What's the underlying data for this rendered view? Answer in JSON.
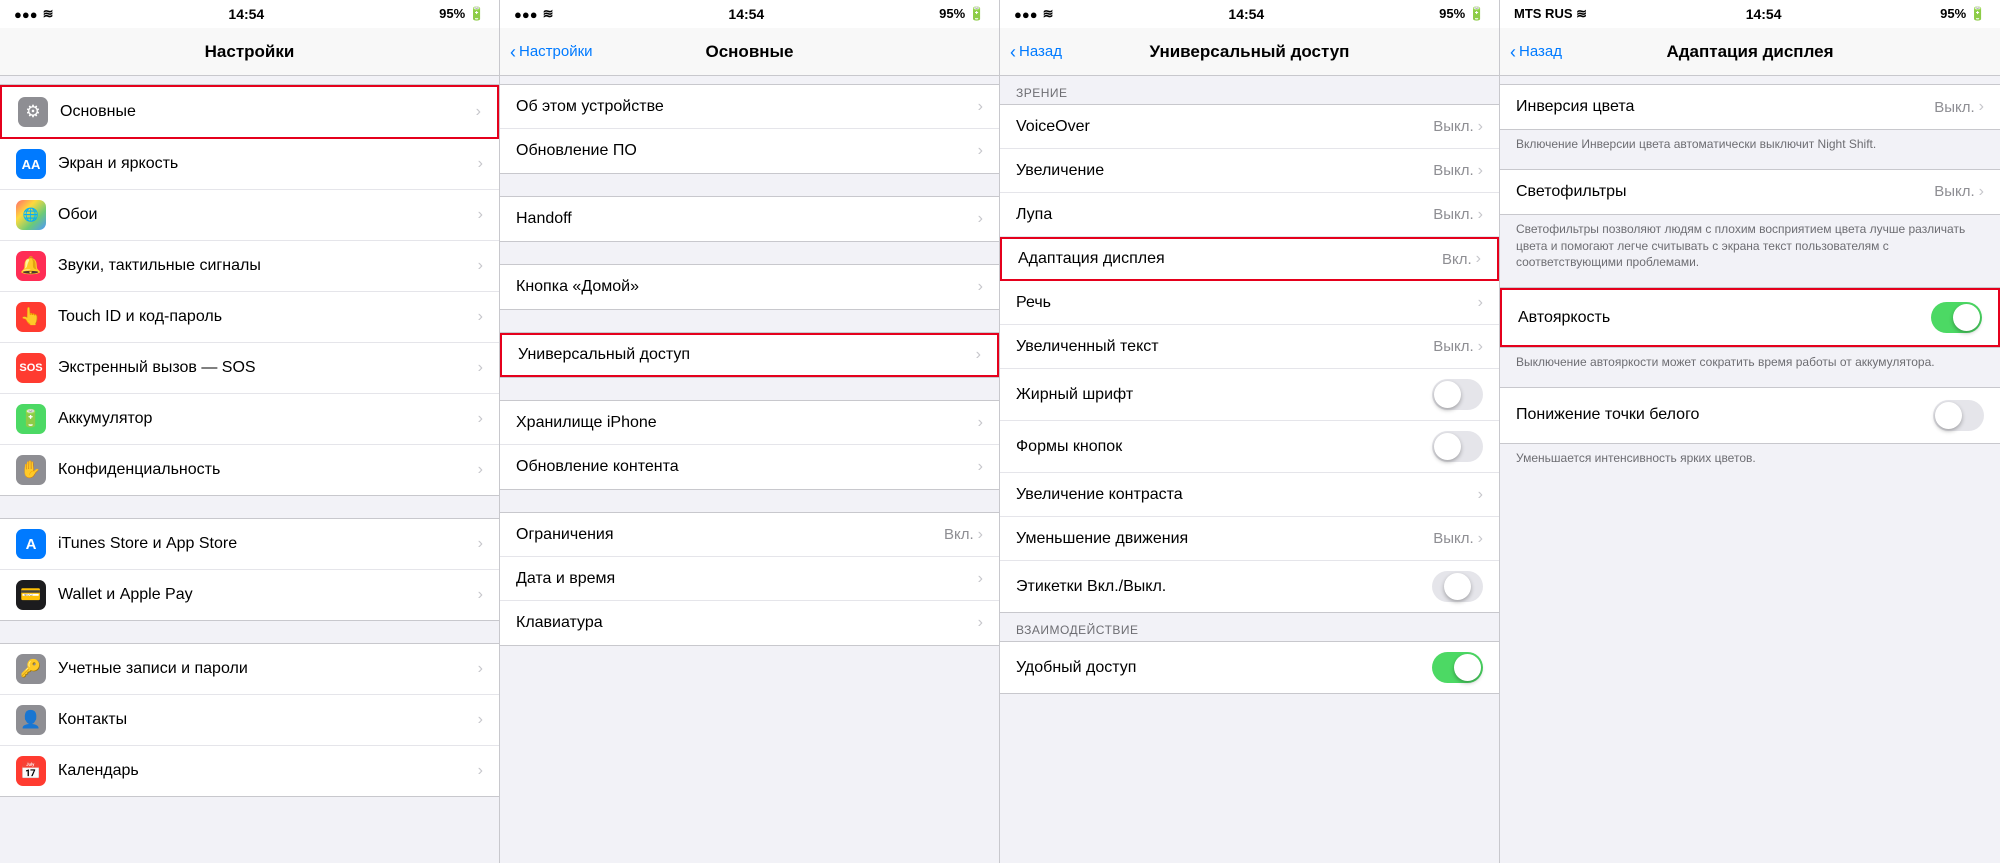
{
  "screens": [
    {
      "id": "screen1",
      "statusBar": {
        "left": "●●● ≋",
        "center": "14:54",
        "right": "95% 🔋"
      },
      "header": {
        "title": "Настройки",
        "backLabel": null
      },
      "groups": [
        {
          "items": [
            {
              "id": "osnovnye",
              "icon": "⚙️",
              "iconBg": "#8e8e93",
              "label": "Основные",
              "value": null,
              "highlighted": true
            },
            {
              "id": "ekran",
              "icon": "AA",
              "iconBg": "#007aff",
              "label": "Экран и яркость",
              "value": null
            },
            {
              "id": "oboi",
              "icon": "🌐",
              "iconBg": "#ff9500",
              "label": "Обои",
              "value": null
            },
            {
              "id": "zvuki",
              "icon": "🔔",
              "iconBg": "#ff2d55",
              "label": "Звуки, тактильные сигналы",
              "value": null
            },
            {
              "id": "touchid",
              "icon": "👆",
              "iconBg": "#ff3b30",
              "label": "Touch ID и код-пароль",
              "value": null
            },
            {
              "id": "ekstrenny",
              "icon": "SOS",
              "iconBg": "#ff3b30",
              "label": "Экстренный вызов — SOS",
              "value": null
            },
            {
              "id": "akkum",
              "icon": "🔋",
              "iconBg": "#4cd964",
              "label": "Аккумулятор",
              "value": null
            },
            {
              "id": "konfid",
              "icon": "✋",
              "iconBg": "#8e8e93",
              "label": "Конфиденциальность",
              "value": null
            }
          ]
        },
        {
          "items": [
            {
              "id": "itunes",
              "icon": "A",
              "iconBg": "#007aff",
              "label": "iTunes Store и App Store",
              "value": null
            },
            {
              "id": "wallet",
              "icon": "💳",
              "iconBg": "#000",
              "label": "Wallet и Apple Pay",
              "value": null
            }
          ]
        },
        {
          "items": [
            {
              "id": "uchet",
              "icon": "🔑",
              "iconBg": "#8e8e93",
              "label": "Учетные записи и пароли",
              "value": null
            },
            {
              "id": "kontakty",
              "icon": "👤",
              "iconBg": "#8e8e93",
              "label": "Контакты",
              "value": null
            },
            {
              "id": "kalendar",
              "icon": "📅",
              "iconBg": "#ff3b30",
              "label": "Календарь",
              "value": null
            }
          ]
        }
      ]
    },
    {
      "id": "screen2",
      "statusBar": {
        "left": "●●● ≋",
        "center": "14:54",
        "right": "95% 🔋"
      },
      "header": {
        "title": "Основные",
        "backLabel": "Настройки"
      },
      "groups": [
        {
          "items": [
            {
              "id": "ob-ustrojstve",
              "label": "Об этом устройстве",
              "value": null
            },
            {
              "id": "obnovlenie-po",
              "label": "Обновление ПО",
              "value": null
            }
          ]
        },
        {
          "items": [
            {
              "id": "handoff",
              "label": "Handoff",
              "value": null
            }
          ]
        },
        {
          "items": [
            {
              "id": "knopka-doma",
              "label": "Кнопка «Домой»",
              "value": null
            }
          ]
        },
        {
          "items": [
            {
              "id": "univ-dostup",
              "label": "Универсальный доступ",
              "value": null,
              "highlighted": true
            }
          ]
        },
        {
          "items": [
            {
              "id": "hranilische",
              "label": "Хранилище iPhone",
              "value": null
            },
            {
              "id": "obnovlenie-kont",
              "label": "Обновление контента",
              "value": null
            }
          ]
        },
        {
          "items": [
            {
              "id": "ogranicheniya",
              "label": "Ограничения",
              "value": "Вкл."
            },
            {
              "id": "data-vremya",
              "label": "Дата и время",
              "value": null
            },
            {
              "id": "klaviatura",
              "label": "Клавиатура",
              "value": null
            }
          ]
        }
      ]
    },
    {
      "id": "screen3",
      "statusBar": {
        "left": "●●● ≋",
        "center": "14:54",
        "right": "95% 🔋"
      },
      "header": {
        "title": "Универсальный доступ",
        "backLabel": "Назад"
      },
      "visionLabel": "ЗРЕНИЕ",
      "visionItems": [
        {
          "id": "voiceover",
          "label": "VoiceOver",
          "value": "Выкл."
        },
        {
          "id": "uvelichenie",
          "label": "Увеличение",
          "value": "Выкл."
        },
        {
          "id": "lupa",
          "label": "Лупа",
          "value": "Выкл."
        },
        {
          "id": "adaptaciya",
          "label": "Адаптация дисплея",
          "value": "Вкл.",
          "highlighted": true
        },
        {
          "id": "rech",
          "label": "Речь",
          "value": null
        },
        {
          "id": "uvelichennyj-tekst",
          "label": "Увеличенный текст",
          "value": "Выкл."
        },
        {
          "id": "zhirnyj-shrift",
          "label": "Жирный шрифт",
          "toggle": "off"
        },
        {
          "id": "formy-knopok",
          "label": "Формы кнопок",
          "toggle": "off"
        },
        {
          "id": "uvelichenie-kontrasta",
          "label": "Увеличение контраста",
          "value": null
        },
        {
          "id": "umenshenie-dvizh",
          "label": "Уменьшение движения",
          "value": "Выкл."
        },
        {
          "id": "etikety",
          "label": "Этикетки Вкл./Выкл.",
          "toggle": "partial"
        }
      ],
      "interactionLabel": "ВЗАИМОДЕЙСТВИЕ",
      "interactionItems": [
        {
          "id": "udobnyj-dostup",
          "label": "Удобный доступ",
          "toggle": "on"
        }
      ]
    },
    {
      "id": "screen4",
      "statusBar": {
        "left": "MTS RUS ≋",
        "center": "14:54",
        "right": "95% 🔋"
      },
      "header": {
        "title": "Адаптация дисплея",
        "backLabel": "Назад"
      },
      "items": [
        {
          "id": "inversiya",
          "label": "Инверсия цвета",
          "value": "Выкл.",
          "description": "Включение Инверсии цвета автоматически выключит Night Shift."
        },
        {
          "id": "svetofiltry",
          "label": "Светофильтры",
          "value": "Выкл.",
          "description": "Светофильтры позволяют людям с плохим восприятием цвета лучше различать цвета и помогают легче считывать с экрана текст пользователям с соответствующими проблемами."
        },
        {
          "id": "avtoyarkost",
          "label": "Автояркость",
          "toggle": "on",
          "highlighted": true,
          "description": "Выключение автояркости может сократить время работы от аккумулятора."
        },
        {
          "id": "ponizh-belogo",
          "label": "Понижение точки белого",
          "toggle": "off",
          "description": "Уменьшается интенсивность ярких цветов."
        }
      ]
    }
  ]
}
